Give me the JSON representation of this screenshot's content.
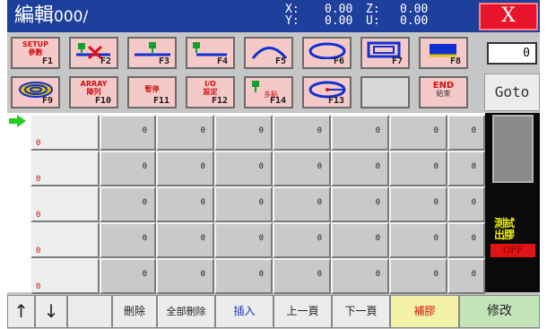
{
  "title": {
    "label": "編輯",
    "file": "000/"
  },
  "coords": {
    "x_label": "X:",
    "y_label": "Y:",
    "z_label": "Z:",
    "u_label": "U:",
    "x": "0.00",
    "y": "0.00",
    "z": "0.00",
    "u": "0.00"
  },
  "close_label": "X",
  "fkeys_row1": [
    {
      "top": "SETUP",
      "bottom": "參數",
      "label": "F1"
    },
    {
      "label": "F2"
    },
    {
      "label": "F3"
    },
    {
      "label": "F4"
    },
    {
      "label": "F5"
    },
    {
      "label": "F6"
    },
    {
      "label": "F7"
    },
    {
      "label": "F8"
    }
  ],
  "fkeys_row2": [
    {
      "label": "F9"
    },
    {
      "top": "ARRAY",
      "bottom": "陣列",
      "label": "F10"
    },
    {
      "top": "",
      "bottom": "暫停",
      "label": "F11"
    },
    {
      "top": "I/O",
      "bottom": "設定",
      "label": "F12"
    },
    {
      "label": "F14",
      "bottom": "多點"
    },
    {
      "label": "F13"
    },
    {
      "label": ""
    },
    {
      "top": "END",
      "bottom": "結束",
      "label": ""
    }
  ],
  "counter": "0",
  "goto_label": "Goto",
  "rows": [
    {
      "index": "0",
      "values": [
        "0",
        "0",
        "0",
        "0",
        "0",
        "0",
        "0"
      ]
    },
    {
      "index": "0",
      "values": [
        "0",
        "0",
        "0",
        "0",
        "0",
        "0",
        "0"
      ]
    },
    {
      "index": "0",
      "values": [
        "0",
        "0",
        "0",
        "0",
        "0",
        "0",
        "0"
      ]
    },
    {
      "index": "0",
      "values": [
        "0",
        "0",
        "0",
        "0",
        "0",
        "0",
        "0"
      ]
    },
    {
      "index": "0",
      "values": [
        "0",
        "0",
        "0",
        "0",
        "0",
        "0",
        "0"
      ]
    }
  ],
  "side_text_line1": "測試",
  "side_text_line2": "出膠",
  "side_red_label": "OFF",
  "bottom": {
    "up": "↑",
    "down": "↓",
    "delete": "刪除",
    "delete_all": "全部刪除",
    "insert": "插入",
    "prev_page": "上一頁",
    "next_page": "下一頁",
    "compensate": "補膠",
    "modify": "修改"
  },
  "colors": {
    "title_bar": "#1f3f9c",
    "close": "#e8142c",
    "fkey_bg": "#f6c9c9",
    "yellow_btn": "#f4f2a6",
    "green_btn": "#c3e5b8"
  },
  "icons": [
    "dispense-on-line-icon",
    "dispense-off-line-icon",
    "line-icon",
    "line-end-icon",
    "arc-icon",
    "circle-icon",
    "rectangle-icon",
    "filled-rect-icon",
    "spiral-icon",
    "multi-point-icon",
    "ellipse-icon",
    "green-arrow-icon"
  ]
}
